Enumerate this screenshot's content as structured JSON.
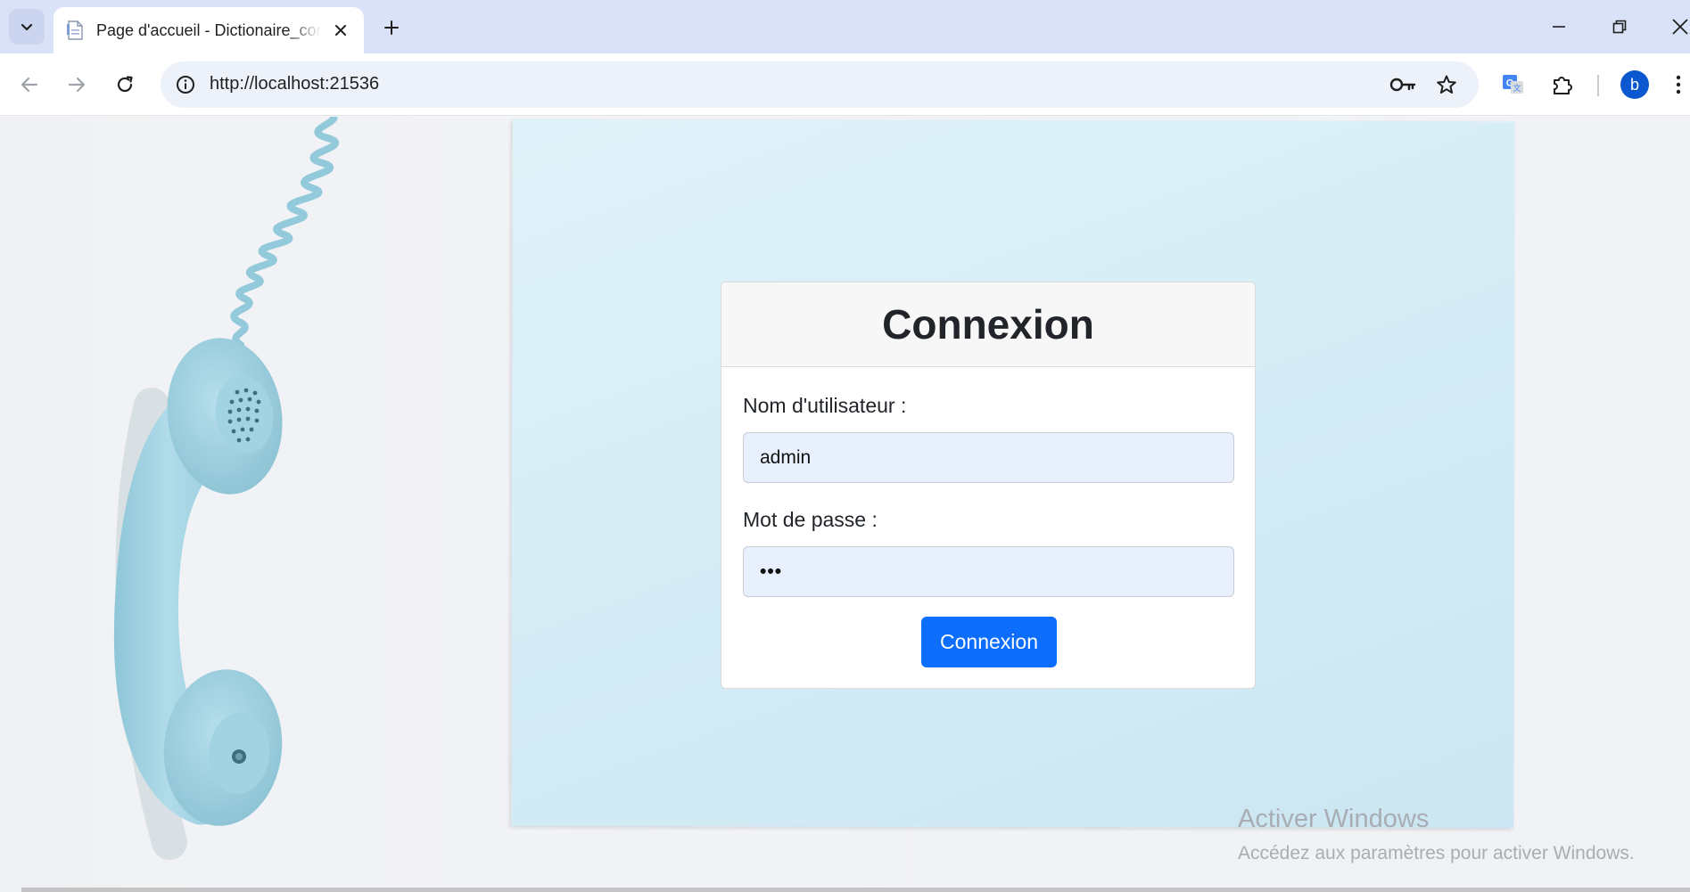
{
  "browser": {
    "tab_title": "Page d'accueil - Dictionaire_con",
    "url": "http://localhost:21536",
    "profile_initial": "b"
  },
  "icons": {
    "tab_search": "chevron-down-icon",
    "favicon": "document-icon",
    "tab_close": "close-icon",
    "new_tab": "plus-icon",
    "back": "arrow-left-icon",
    "forward": "arrow-right-icon",
    "reload": "reload-icon",
    "site_info": "info-icon",
    "passwords": "key-icon",
    "bookmark": "star-icon",
    "translate": "google-translate-icon",
    "extensions": "puzzle-icon",
    "menu": "kebab-menu-icon"
  },
  "login": {
    "title": "Connexion",
    "username_label": "Nom d'utilisateur :",
    "username_value": "admin",
    "password_label": "Mot de passe :",
    "password_value": "•••",
    "submit_label": "Connexion"
  },
  "watermark": {
    "title": "Activer Windows",
    "subtitle": "Accédez aux paramètres pour activer Windows."
  },
  "colors": {
    "primary_button": "#0d6efd",
    "input_background": "#e8f0fe",
    "tabstrip": "#dae2f8",
    "avatar": "#0b57d0",
    "phone": "#a8d6e4"
  }
}
